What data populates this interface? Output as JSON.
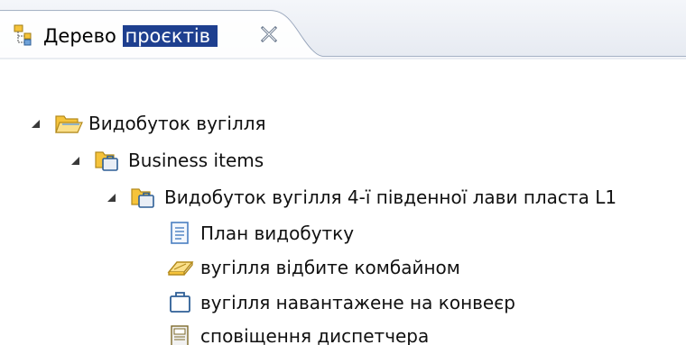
{
  "view_tab": {
    "title_part1": "Дерево",
    "title_part2": "проєктів",
    "icon": "project-tree-icon",
    "close_icon": "close-icon"
  },
  "tree": {
    "root": {
      "label": "Видобуток вугілля",
      "icon": "open-folder-icon",
      "expanded": true
    },
    "business_items": {
      "label": "Business items",
      "icon": "business-folder-icon",
      "expanded": true
    },
    "item_folder": {
      "label": "Видобуток вугілля 4-ї південної лави пласта L1",
      "icon": "business-folder-icon",
      "expanded": true
    },
    "leaves": [
      {
        "label": "План видобутку",
        "icon": "document-icon"
      },
      {
        "label": "вугілля відбите комбайном",
        "icon": "eraser-item-icon"
      },
      {
        "label": "вугілля навантажене на конвеєр",
        "icon": "package-icon"
      },
      {
        "label": "сповіщення диспетчера",
        "icon": "notification-icon"
      }
    ]
  },
  "colors": {
    "selection": "#1e3f8f",
    "folder_yellow": "#f5c33b",
    "folder_blue": "#4a7fc1",
    "tab_border": "#8e9db5"
  }
}
